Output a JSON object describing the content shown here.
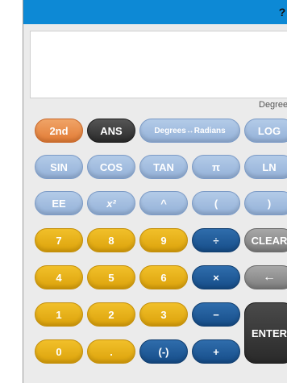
{
  "header": {
    "help_label": "?"
  },
  "display": {
    "mode_label": "Degrees"
  },
  "keys": {
    "second": "2nd",
    "ans": "ANS",
    "deg_rad": "Degrees↔Radians",
    "log": "LOG",
    "sin": "SIN",
    "cos": "COS",
    "tan": "TAN",
    "pi": "π",
    "ln": "LN",
    "ee": "EE",
    "square": "x²",
    "power": "^",
    "lparen": "(",
    "rparen": ")",
    "seven": "7",
    "eight": "8",
    "nine": "9",
    "divide": "÷",
    "clear": "CLEAR",
    "four": "4",
    "five": "5",
    "six": "6",
    "multiply": "×",
    "backspace": "←",
    "one": "1",
    "two": "2",
    "three": "3",
    "minus": "−",
    "enter": "ENTER",
    "zero": "0",
    "decimal": ".",
    "negate": "(-)",
    "plus": "+"
  },
  "colors": {
    "title_bar": "#0d89d5",
    "blue_key": "#a4bfe0",
    "gold_key": "#e6b11a",
    "navy_key": "#1f5a98",
    "orange_key": "#e88a48",
    "black_key": "#333333"
  }
}
